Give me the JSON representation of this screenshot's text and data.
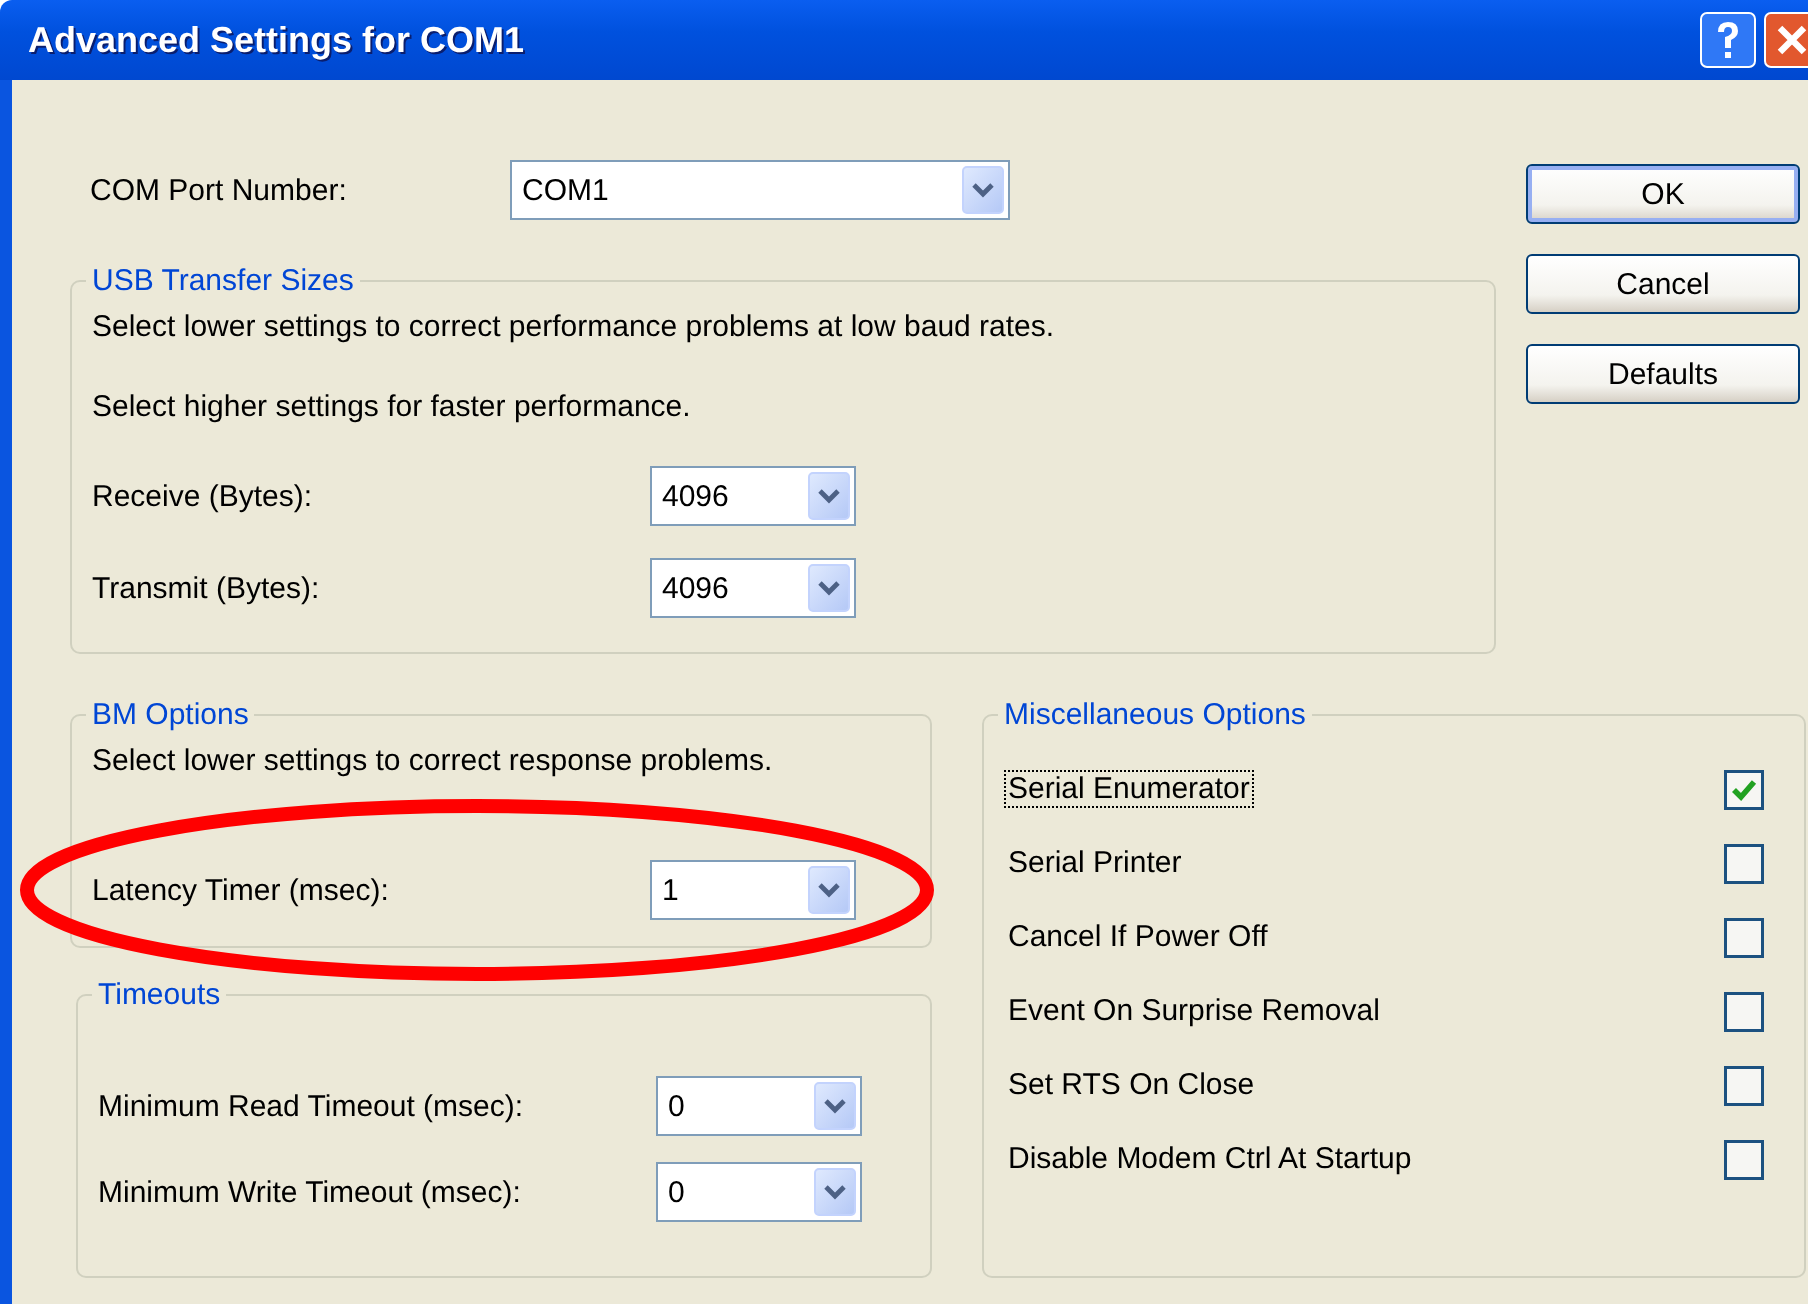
{
  "window": {
    "title": "Advanced Settings for COM1"
  },
  "com_port": {
    "label": "COM Port Number:",
    "value": "COM1"
  },
  "buttons": [
    {
      "label": "OK",
      "default": true
    },
    {
      "label": "Cancel",
      "default": false
    },
    {
      "label": "Defaults",
      "default": false
    }
  ],
  "usb_transfer_sizes": {
    "title": "USB Transfer Sizes",
    "notes": [
      "Select lower settings to correct performance problems at low baud rates.",
      "Select higher settings for faster performance."
    ],
    "fields": [
      {
        "label": "Receive (Bytes):",
        "value": "4096",
        "circled": false
      },
      {
        "label": "Transmit (Bytes):",
        "value": "4096",
        "circled": false
      }
    ]
  },
  "bm_options": {
    "title": "BM Options",
    "notes": [
      "Select lower settings to correct response problems."
    ],
    "fields": [
      {
        "label": "Latency Timer (msec):",
        "value": "1",
        "circled": true
      }
    ]
  },
  "timeouts": {
    "title": "Timeouts",
    "fields": [
      {
        "label": "Minimum Read Timeout (msec):",
        "value": "0",
        "circled": false
      },
      {
        "label": "Minimum Write Timeout (msec):",
        "value": "0",
        "circled": false
      }
    ]
  },
  "misc_options": {
    "title": "Miscellaneous Options",
    "items": [
      {
        "label": "Serial Enumerator",
        "checked": true,
        "focused": true
      },
      {
        "label": "Serial Printer",
        "checked": false,
        "focused": false
      },
      {
        "label": "Cancel If Power Off",
        "checked": false,
        "focused": false
      },
      {
        "label": "Event On Surprise Removal",
        "checked": false,
        "focused": false
      },
      {
        "label": "Set RTS On Close",
        "checked": false,
        "focused": false
      },
      {
        "label": "Disable Modem Ctrl At Startup",
        "checked": false,
        "focused": false
      }
    ]
  }
}
